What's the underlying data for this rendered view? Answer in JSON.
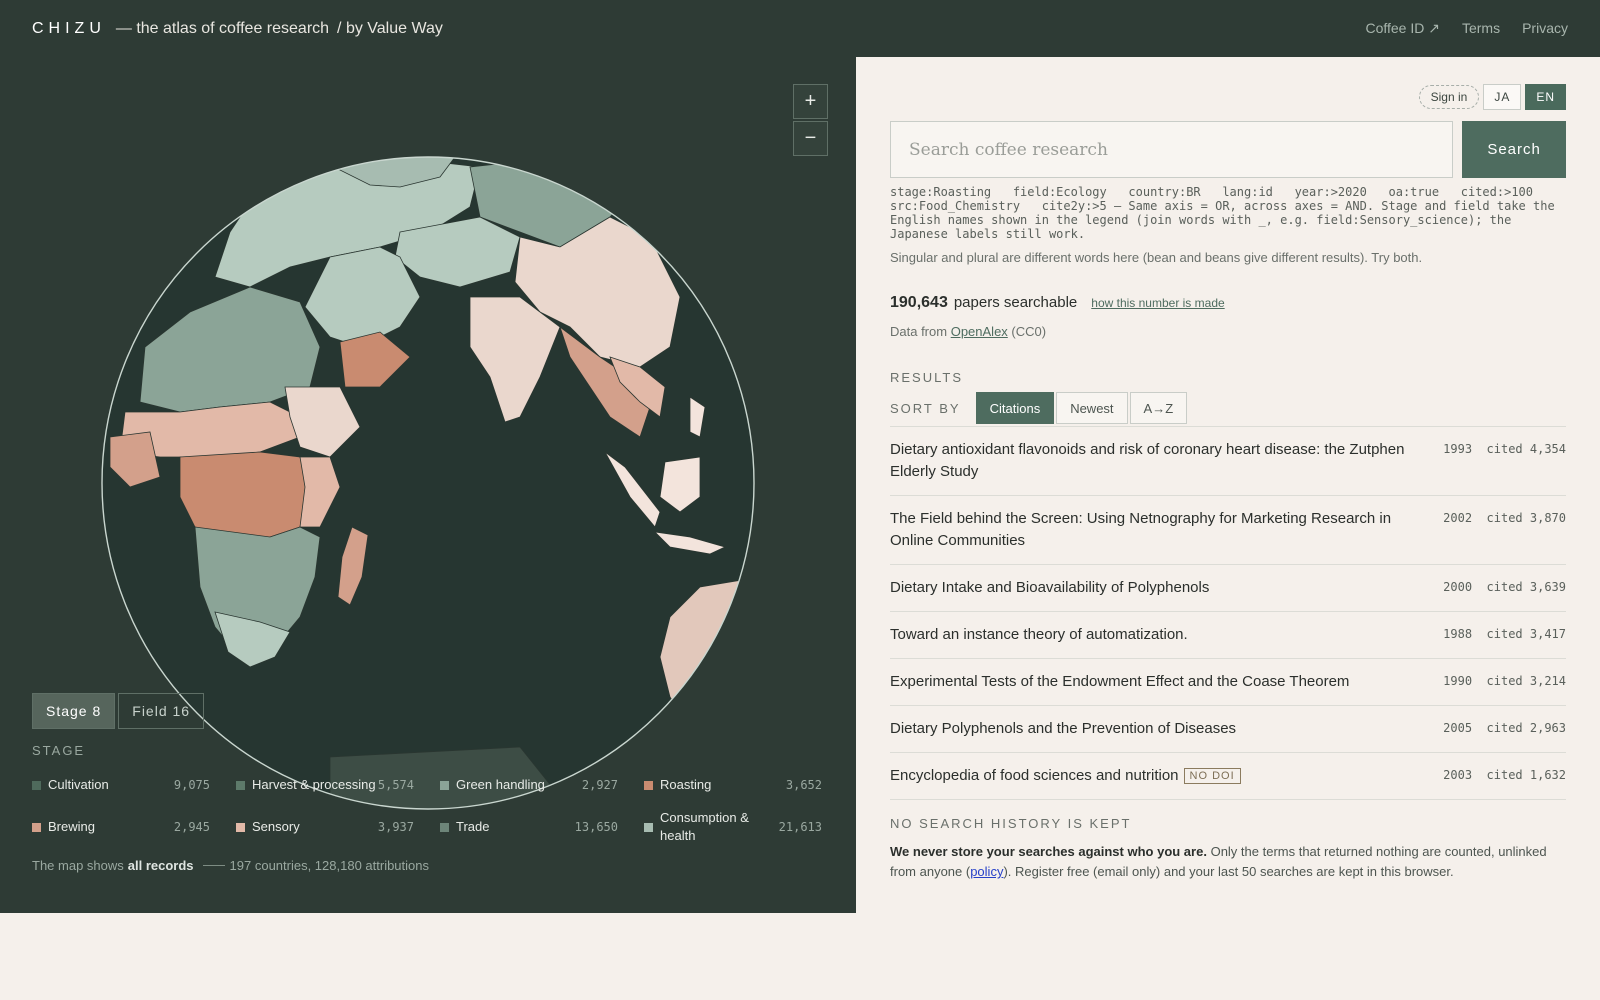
{
  "header": {
    "brand": "CHIZU",
    "tagline": "— the atlas of coffee research",
    "byline": "/ by Value Way",
    "nav": [
      "Coffee ID ↗",
      "Terms",
      "Privacy"
    ]
  },
  "map": {
    "zoom_in": "+",
    "zoom_out": "−",
    "toggles": [
      {
        "label": "Stage 8",
        "active": true
      },
      {
        "label": "Field 16",
        "active": false
      }
    ],
    "legend_title": "STAGE",
    "legend": [
      {
        "label": "Cultivation",
        "count": "9,075",
        "color": "#4f6a5c"
      },
      {
        "label": "Harvest & processing",
        "count": "5,574",
        "color": "#5d7a6a"
      },
      {
        "label": "Green handling",
        "count": "2,927",
        "color": "#8ba497"
      },
      {
        "label": "Roasting",
        "count": "3,652",
        "color": "#c98b70"
      },
      {
        "label": "Brewing",
        "count": "2,945",
        "color": "#d3a08b"
      },
      {
        "label": "Sensory",
        "count": "3,937",
        "color": "#e2b9a8"
      },
      {
        "label": "Trade",
        "count": "13,650",
        "color": "#6d8579"
      },
      {
        "label": "Consumption & health",
        "count": "21,613",
        "color": "#a7bcb1"
      }
    ],
    "footer": {
      "prefix": "The map shows",
      "bold": "all records",
      "suffix": "197 countries, 128,180 attributions"
    },
    "colors": {
      "background": "#2e3b35",
      "ocean": "#263631",
      "outline": "#c9d6cf"
    }
  },
  "auth": {
    "sign_in": "Sign in",
    "languages": [
      {
        "code": "JA",
        "active": false
      },
      {
        "code": "EN",
        "active": true
      }
    ]
  },
  "search": {
    "placeholder": "Search coffee research",
    "value": "",
    "button": "Search",
    "syntax": "stage:Roasting   field:Ecology   country:BR   lang:id   year:>2020   oa:true   cited:>100\nsrc:Food_Chemistry   cite2y:>5 — Same axis = OR, across axes = AND. Stage and field take the English names shown in the legend (join words with _, e.g. field:Sensory_science); the Japanese labels still work.",
    "hint": "Singular and plural are different words here (bean and beans give different results). Try both."
  },
  "stats": {
    "count": "190,643",
    "count_suffix": "papers searchable",
    "how_link": "how this number is made",
    "source_prefix": "Data from",
    "source_link": "OpenAlex",
    "source_suffix": "(CC0)"
  },
  "results": {
    "heading": "RESULTS",
    "sort_label": "SORT BY",
    "sort_options": [
      {
        "label": "Citations",
        "active": true
      },
      {
        "label": "Newest",
        "active": false
      },
      {
        "label": "A→Z",
        "active": false
      }
    ],
    "items": [
      {
        "title": "Dietary antioxidant flavonoids and risk of coronary heart disease: the Zutphen Elderly Study",
        "year": "1993",
        "cited": "cited 4,354",
        "badge": ""
      },
      {
        "title": "The Field behind the Screen: Using Netnography for Marketing Research in Online Communities",
        "year": "2002",
        "cited": "cited 3,870",
        "badge": ""
      },
      {
        "title": "Dietary Intake and Bioavailability of Polyphenols",
        "year": "2000",
        "cited": "cited 3,639",
        "badge": ""
      },
      {
        "title": "Toward an instance theory of automatization.",
        "year": "1988",
        "cited": "cited 3,417",
        "badge": ""
      },
      {
        "title": "Experimental Tests of the Endowment Effect and the Coase Theorem",
        "year": "1990",
        "cited": "cited 3,214",
        "badge": ""
      },
      {
        "title": "Dietary Polyphenols and the Prevention of Diseases",
        "year": "2005",
        "cited": "cited 2,963",
        "badge": ""
      },
      {
        "title": "Encyclopedia of food sciences and nutrition",
        "year": "2003",
        "cited": "cited 1,632",
        "badge": "NO DOI"
      }
    ]
  },
  "privacy": {
    "heading": "NO SEARCH HISTORY IS KEPT",
    "bold": "We never store your searches against who you are.",
    "text_a": "Only the terms that returned nothing are counted, unlinked from anyone (",
    "link": "policy",
    "text_b": "). Register free (email only) and your last 50 searches are kept in this browser."
  }
}
